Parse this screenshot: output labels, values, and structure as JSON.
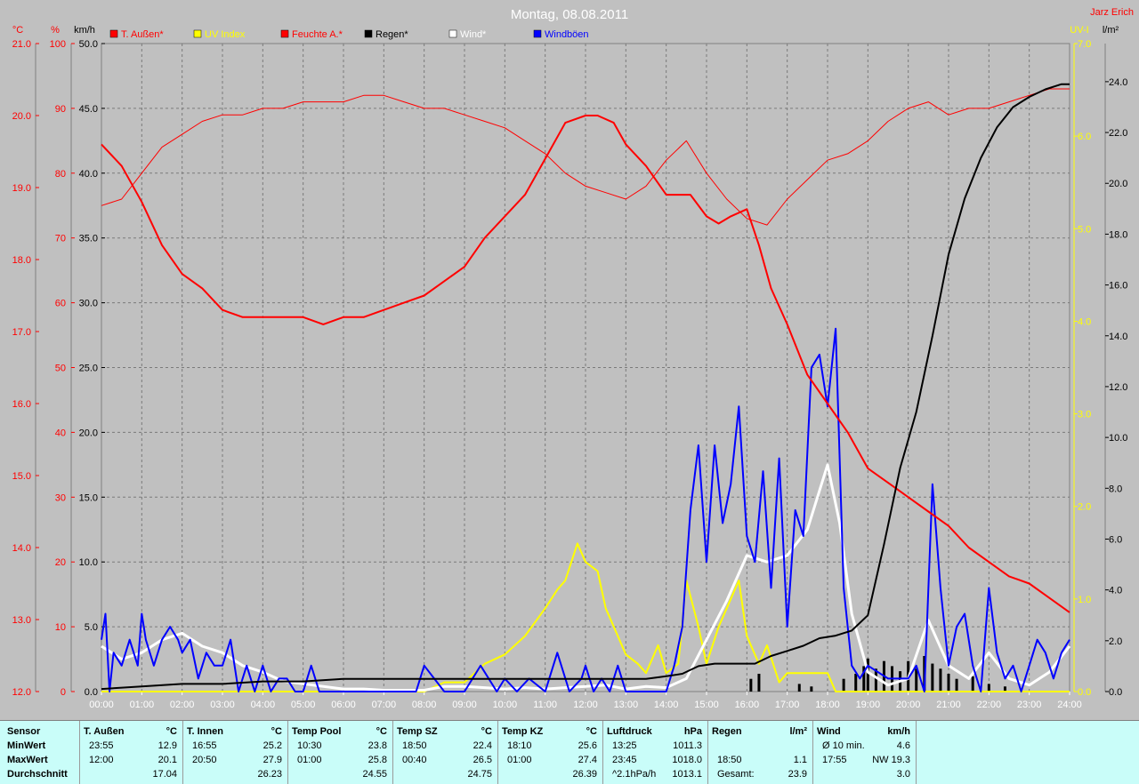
{
  "title": "Montag, 08.08.2011",
  "author": "Jarz Erich",
  "legend": [
    {
      "label": "T. Außen*",
      "color": "#ff0000"
    },
    {
      "label": "UV Index",
      "color": "#ffff00"
    },
    {
      "label": "Feuchte A.*",
      "color": "#ff0000"
    },
    {
      "label": "Regen*",
      "color": "#000000"
    },
    {
      "label": "Wind*",
      "color": "#ffffff"
    },
    {
      "label": "Windböen",
      "color": "#0000ff"
    }
  ],
  "axis_units": {
    "temp": "°C",
    "humidity": "%",
    "wind": "km/h",
    "uv": "UV-I",
    "rain": "l/m²"
  },
  "colors": {
    "bg": "#c0c0c0",
    "red": "#ff0000",
    "yellow": "#ffff00",
    "blue": "#0000ff",
    "white": "#ffffff",
    "black": "#000000",
    "stats_bg": "#c9fdf9"
  },
  "chart_data": {
    "type": "line",
    "title": "Montag, 08.08.2011",
    "x_ticks": [
      "00:00",
      "01:00",
      "02:00",
      "03:00",
      "04:00",
      "05:00",
      "06:00",
      "07:00",
      "08:00",
      "09:00",
      "10:00",
      "11:00",
      "12:00",
      "13:00",
      "14:00",
      "15:00",
      "16:00",
      "17:00",
      "18:00",
      "19:00",
      "20:00",
      "21:00",
      "22:00",
      "23:00",
      "24:00"
    ],
    "xlim": [
      0,
      24
    ],
    "axes": {
      "temp": {
        "label": "°C",
        "range": [
          12.0,
          21.0
        ],
        "ticks": [
          "12.0",
          "13.0",
          "14.0",
          "15.0",
          "16.0",
          "17.0",
          "18.0",
          "19.0",
          "20.0",
          "21.0"
        ],
        "color": "#ff0000"
      },
      "humidity": {
        "label": "%",
        "range": [
          0,
          100
        ],
        "ticks": [
          "0",
          "10",
          "20",
          "30",
          "40",
          "50",
          "60",
          "70",
          "80",
          "90",
          "100"
        ],
        "color": "#ff0000"
      },
      "wind": {
        "label": "km/h",
        "range": [
          0,
          50
        ],
        "ticks": [
          "0.0",
          "5.0",
          "10.0",
          "15.0",
          "20.0",
          "25.0",
          "30.0",
          "35.0",
          "40.0",
          "45.0",
          "50.0"
        ],
        "color": "#000000"
      },
      "uv": {
        "label": "UV-I",
        "range": [
          0,
          7
        ],
        "ticks": [
          "0.0",
          "1.0",
          "2.0",
          "3.0",
          "4.0",
          "5.0",
          "6.0",
          "7.0"
        ],
        "color": "#ffff00"
      },
      "rain": {
        "label": "l/m²",
        "range": [
          0,
          25.5
        ],
        "ticks": [
          "0.0",
          "2.0",
          "4.0",
          "6.0",
          "8.0",
          "10.0",
          "12.0",
          "14.0",
          "16.0",
          "18.0",
          "20.0",
          "22.0",
          "24.0"
        ],
        "color": "#000000"
      }
    },
    "grid": true,
    "series": [
      {
        "name": "T. Außen*",
        "axis": "temp",
        "color": "#ff0000",
        "width": 2,
        "x": [
          0,
          0.5,
          1,
          1.5,
          2,
          2.5,
          3,
          3.5,
          4,
          4.5,
          5,
          5.5,
          6,
          6.5,
          7,
          7.5,
          8,
          8.5,
          9,
          9.5,
          10,
          10.5,
          11,
          11.5,
          12,
          12.3,
          12.7,
          13,
          13.5,
          14,
          14.3,
          14.6,
          15,
          15.3,
          15.6,
          16,
          16.3,
          16.6,
          17,
          17.5,
          18,
          18.5,
          19,
          19.5,
          20,
          20.5,
          21,
          21.5,
          22,
          22.5,
          23,
          23.5,
          24
        ],
        "y": [
          19.6,
          19.3,
          18.8,
          18.2,
          17.8,
          17.6,
          17.3,
          17.2,
          17.2,
          17.2,
          17.2,
          17.1,
          17.2,
          17.2,
          17.3,
          17.4,
          17.5,
          17.7,
          17.9,
          18.3,
          18.6,
          18.9,
          19.4,
          19.9,
          20.0,
          20.0,
          19.9,
          19.6,
          19.3,
          18.9,
          18.9,
          18.9,
          18.6,
          18.5,
          18.6,
          18.7,
          18.2,
          17.6,
          17.1,
          16.4,
          16.0,
          15.6,
          15.1,
          14.9,
          14.7,
          14.5,
          14.3,
          14.0,
          13.8,
          13.6,
          13.5,
          13.3,
          13.1
        ]
      },
      {
        "name": "Feuchte A.*",
        "axis": "humidity",
        "color": "#ff0000",
        "width": 1,
        "x": [
          0,
          0.5,
          1,
          1.5,
          2,
          2.5,
          3,
          3.5,
          4,
          4.5,
          5,
          5.5,
          6,
          6.5,
          7,
          7.5,
          8,
          8.5,
          9,
          9.5,
          10,
          10.5,
          11,
          11.5,
          12,
          12.5,
          13,
          13.5,
          14,
          14.5,
          15,
          15.5,
          16,
          16.5,
          17,
          17.5,
          18,
          18.5,
          19,
          19.5,
          20,
          20.5,
          21,
          21.5,
          22,
          22.5,
          23,
          23.5,
          24
        ],
        "y": [
          75,
          76,
          80,
          84,
          86,
          88,
          89,
          89,
          90,
          90,
          91,
          91,
          91,
          92,
          92,
          91,
          90,
          90,
          89,
          88,
          87,
          85,
          83,
          80,
          78,
          77,
          76,
          78,
          82,
          85,
          80,
          76,
          73,
          72,
          76,
          79,
          82,
          83,
          85,
          88,
          90,
          91,
          89,
          90,
          90,
          91,
          92,
          93,
          93
        ]
      },
      {
        "name": "Regen*",
        "axis": "rain",
        "color": "#000000",
        "width": 2,
        "x": [
          0,
          1,
          2,
          3,
          4,
          5,
          6,
          7,
          8,
          9,
          10,
          11,
          12,
          13,
          13.5,
          14,
          14.4,
          14.8,
          15.2,
          15.8,
          16.2,
          16.6,
          17,
          17.4,
          17.8,
          18.2,
          18.6,
          19,
          19.4,
          19.8,
          20.2,
          20.6,
          21,
          21.4,
          21.8,
          22.2,
          22.6,
          23,
          23.4,
          23.8,
          24
        ],
        "y": [
          0.1,
          0.2,
          0.3,
          0.3,
          0.4,
          0.4,
          0.5,
          0.5,
          0.5,
          0.5,
          0.5,
          0.5,
          0.5,
          0.5,
          0.5,
          0.6,
          0.7,
          1.0,
          1.1,
          1.1,
          1.1,
          1.4,
          1.6,
          1.8,
          2.1,
          2.2,
          2.4,
          3.0,
          5.8,
          8.8,
          11.0,
          14.0,
          17.2,
          19.4,
          21.0,
          22.2,
          23.0,
          23.4,
          23.7,
          23.9,
          23.9
        ]
      },
      {
        "name": "UV Index",
        "axis": "uv",
        "color": "#ffff00",
        "width": 2,
        "x": [
          0,
          8,
          8.5,
          9,
          9.5,
          10,
          10.5,
          11,
          11.3,
          11.5,
          11.8,
          12,
          12.3,
          12.5,
          12.8,
          13,
          13.3,
          13.5,
          13.8,
          14,
          14.3,
          14.5,
          14.8,
          15,
          15.3,
          15.5,
          15.8,
          16,
          16.3,
          16.5,
          16.8,
          17,
          17.5,
          18,
          18.2,
          24
        ],
        "y": [
          0,
          0,
          0.1,
          0.1,
          0.3,
          0.4,
          0.6,
          0.9,
          1.1,
          1.2,
          1.6,
          1.4,
          1.3,
          0.9,
          0.6,
          0.4,
          0.3,
          0.2,
          0.5,
          0.2,
          0.3,
          1.2,
          0.7,
          0.3,
          0.7,
          0.9,
          1.2,
          0.6,
          0.3,
          0.5,
          0.1,
          0.2,
          0.2,
          0.2,
          0,
          0
        ]
      },
      {
        "name": "Wind*",
        "axis": "wind",
        "color": "#ffffff",
        "width": 3,
        "x": [
          0,
          0.5,
          1,
          1.5,
          2,
          2.5,
          3,
          3.5,
          4,
          4.5,
          5,
          5.5,
          6,
          6.5,
          7,
          7.5,
          8,
          8.5,
          9,
          9.5,
          10,
          10.5,
          11,
          11.5,
          12,
          12.5,
          13,
          13.5,
          14,
          14.5,
          15,
          15.5,
          16,
          16.5,
          17,
          17.5,
          18,
          18.3,
          18.6,
          19,
          19.5,
          20,
          20.5,
          21,
          21.5,
          22,
          22.5,
          23,
          23.5,
          24
        ],
        "y": [
          3.5,
          2.5,
          3.0,
          4.0,
          4.5,
          3.5,
          3.0,
          2.0,
          1.5,
          0.8,
          0.6,
          0.4,
          0.2,
          0.2,
          0.1,
          0.1,
          0.1,
          0.4,
          0.4,
          0.3,
          0.2,
          0.3,
          0.2,
          0.3,
          0.4,
          0.5,
          0.2,
          0.4,
          0.3,
          1.0,
          4.0,
          7.0,
          10.5,
          10.0,
          10.5,
          12.5,
          17.5,
          13.0,
          6.0,
          1.5,
          0.5,
          1.0,
          5.5,
          2.0,
          1.0,
          3.0,
          1.0,
          0.5,
          1.5,
          3.5
        ]
      },
      {
        "name": "Windböen",
        "axis": "wind",
        "color": "#0000ff",
        "width": 2,
        "x": [
          0,
          0.1,
          0.2,
          0.3,
          0.5,
          0.7,
          0.9,
          1.0,
          1.1,
          1.3,
          1.5,
          1.7,
          1.9,
          2.0,
          2.2,
          2.4,
          2.6,
          2.8,
          3.0,
          3.2,
          3.4,
          3.6,
          3.8,
          4.0,
          4.2,
          4.4,
          4.6,
          4.8,
          5.0,
          5.2,
          5.4,
          5.6,
          5.8,
          6.0,
          7.0,
          7.5,
          7.8,
          8.0,
          8.5,
          9.0,
          9.4,
          9.8,
          10.0,
          10.3,
          10.6,
          11.0,
          11.3,
          11.6,
          11.9,
          12.0,
          12.2,
          12.4,
          12.6,
          12.8,
          13.0,
          13.5,
          14.0,
          14.2,
          14.4,
          14.6,
          14.8,
          15.0,
          15.2,
          15.4,
          15.6,
          15.8,
          16.0,
          16.2,
          16.4,
          16.6,
          16.8,
          17.0,
          17.2,
          17.4,
          17.6,
          17.8,
          18.0,
          18.2,
          18.4,
          18.6,
          18.8,
          19.0,
          19.5,
          20.0,
          20.2,
          20.4,
          20.6,
          20.8,
          21.0,
          21.2,
          21.4,
          21.6,
          21.8,
          22.0,
          22.2,
          22.4,
          22.6,
          22.8,
          23.0,
          23.2,
          23.4,
          23.6,
          23.8,
          24.0
        ],
        "y": [
          4,
          6,
          0,
          3,
          2,
          4,
          2,
          6,
          4,
          2,
          4,
          5,
          4,
          3,
          4,
          1,
          3,
          2,
          2,
          4,
          0,
          2,
          0,
          2,
          0,
          1,
          1,
          0,
          0,
          2,
          0,
          0,
          0,
          0,
          0,
          0,
          0,
          2,
          0,
          0,
          2,
          0,
          1,
          0,
          1,
          0,
          3,
          0,
          1,
          2,
          0,
          1,
          0,
          2,
          0,
          0,
          0,
          2,
          5,
          14,
          19,
          10,
          19,
          13,
          16,
          22,
          12,
          10,
          17,
          8,
          18,
          5,
          14,
          12,
          25,
          26,
          22,
          28,
          8,
          2,
          1,
          2,
          1,
          1,
          2,
          0,
          16,
          8,
          2,
          5,
          6,
          2,
          0,
          8,
          3,
          1,
          2,
          0,
          2,
          4,
          3,
          1,
          3,
          4
        ]
      }
    ],
    "rain_bars": {
      "axis": "rain",
      "color": "#000000",
      "x": [
        16.1,
        16.3,
        17.3,
        17.6,
        18.4,
        18.7,
        18.9,
        19.0,
        19.2,
        19.4,
        19.6,
        19.8,
        20.0,
        20.2,
        20.4,
        20.6,
        20.8,
        21.0,
        21.2,
        21.6,
        22.0,
        22.4
      ],
      "y": [
        0.5,
        0.7,
        0.3,
        0.2,
        0.5,
        0.7,
        1.0,
        1.3,
        0.9,
        1.2,
        1.0,
        0.8,
        1.2,
        0.9,
        1.4,
        1.1,
        0.9,
        0.7,
        0.5,
        0.6,
        0.3,
        0.2
      ]
    }
  },
  "stats": {
    "row_labels": [
      "Sensor",
      "MinWert",
      "MaxWert",
      "Durchschnitt"
    ],
    "columns": [
      {
        "name": "T. Außen",
        "unit": "°C",
        "min_time": "23:55",
        "min": "12.9",
        "max_time": "12:00",
        "max": "20.1",
        "avg_note": "",
        "avg": "17.04"
      },
      {
        "name": "T. Innen",
        "unit": "°C",
        "min_time": "16:55",
        "min": "25.2",
        "max_time": "20:50",
        "max": "27.9",
        "avg_note": "",
        "avg": "26.23"
      },
      {
        "name": "Temp Pool",
        "unit": "°C",
        "min_time": "10:30",
        "min": "23.8",
        "max_time": "01:00",
        "max": "25.8",
        "avg_note": "",
        "avg": "24.55"
      },
      {
        "name": "Temp SZ",
        "unit": "°C",
        "min_time": "18:50",
        "min": "22.4",
        "max_time": "00:40",
        "max": "26.5",
        "avg_note": "",
        "avg": "24.75"
      },
      {
        "name": "Temp KZ",
        "unit": "°C",
        "min_time": "18:10",
        "min": "25.6",
        "max_time": "01:00",
        "max": "27.4",
        "avg_note": "",
        "avg": "26.39"
      },
      {
        "name": "Luftdruck",
        "unit": "hPa",
        "min_time": "13:25",
        "min": "1011.3",
        "max_time": "23:45",
        "max": "1018.0",
        "avg_note": "^2.1hPa/h",
        "avg": "1013.1"
      },
      {
        "name": "Regen",
        "unit": "l/m²",
        "min_time": "",
        "min": "",
        "max_time": "18:50",
        "max": "1.1",
        "avg_note": "Gesamt:",
        "avg": "23.9"
      },
      {
        "name": "Wind",
        "unit": "km/h",
        "min_time": "Ø 10 min.",
        "min": "4.6",
        "max_time": "17:55",
        "max": "NW 19.3",
        "avg_note": "",
        "avg": "3.0"
      }
    ]
  }
}
